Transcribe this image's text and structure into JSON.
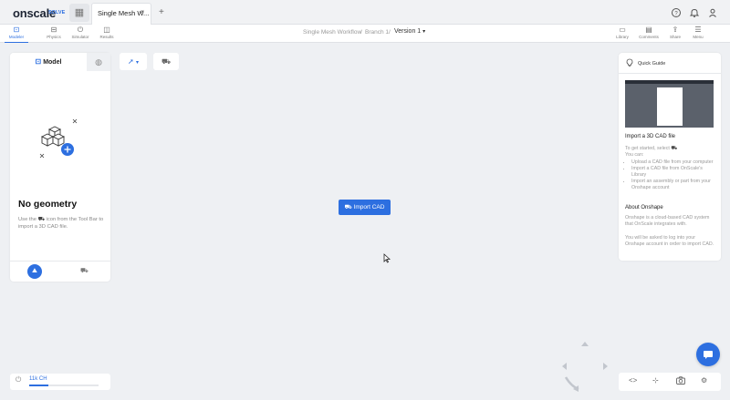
{
  "app": {
    "logo_main": "onscale",
    "logo_sub": "SOLVE"
  },
  "tabs": {
    "grid_icon": "grid-icon",
    "doc_tab_label": "Single Mesh W...",
    "close_glyph": "×",
    "new_tab_glyph": "+"
  },
  "top_icons": [
    "help-icon",
    "bell-icon",
    "user-icon"
  ],
  "modes": [
    {
      "label": "Modeler",
      "icon": "model-icon",
      "active": true
    },
    {
      "label": "Physics",
      "icon": "physics-icon",
      "active": false
    },
    {
      "label": "Simulator",
      "icon": "power-icon",
      "active": false
    },
    {
      "label": "Results",
      "icon": "results-icon",
      "active": false
    }
  ],
  "breadcrumb": {
    "workflow": "Single Mesh Workflow",
    "sep": "/",
    "branch": "Branch 1",
    "sep2": "/",
    "version": "Version 1"
  },
  "right_tools": [
    {
      "label": "Library",
      "icon": "library-icon"
    },
    {
      "label": "Comments",
      "icon": "comments-icon"
    },
    {
      "label": "Share",
      "icon": "share-icon"
    },
    {
      "label": "Menu",
      "icon": "menu-icon"
    }
  ],
  "left_panel": {
    "tab_model": "Model",
    "empty_title": "No geometry",
    "empty_text_pre": "Use the",
    "empty_text_post": "icon from the Tool Bar to import a 3D CAD file."
  },
  "center": {
    "import_button": "Import CAD"
  },
  "quick_guide": {
    "title": "Quick Guide",
    "section1_title": "Import a 3D CAD file",
    "intro_pre": "To get started, select",
    "intro_post": "You can:",
    "bullets": [
      "Upload a CAD file from your computer",
      "Import a CAD file from OnScale's Library",
      "Import an assembly or part from your Onshape account"
    ],
    "section2_title": "About Onshape",
    "onshape_p1": "Onshape is a cloud-based CAD system that OnScale integrates with.",
    "onshape_p2": "You will be asked to log into your Onshape account in order to import CAD."
  },
  "status": {
    "label": "11k CH",
    "progress": 0.28
  },
  "colors": {
    "accent": "#2d6fe0",
    "background": "#eef0f3"
  }
}
